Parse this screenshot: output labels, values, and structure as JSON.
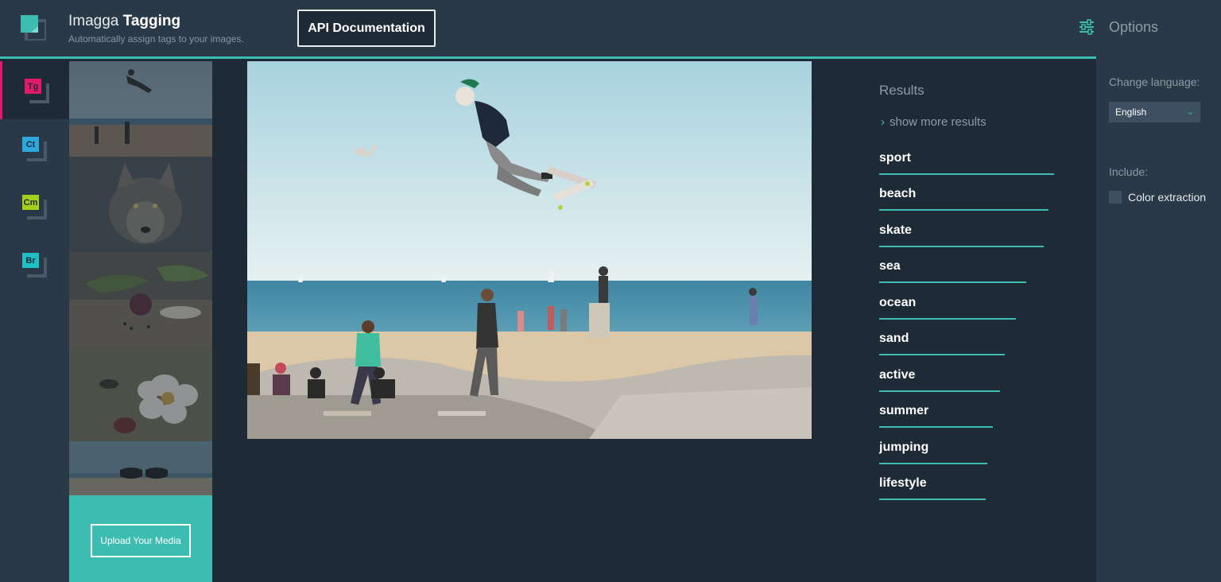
{
  "header": {
    "brand_prefix": "Imagga",
    "brand_name": "Tagging",
    "subtitle": "Automatically assign tags to your images.",
    "api_doc_label": "API Documentation"
  },
  "rail": {
    "items": [
      {
        "code": "Tg",
        "color": "#e0196b",
        "active": true
      },
      {
        "code": "Ct",
        "color": "#2ea8dc",
        "active": false
      },
      {
        "code": "Cm",
        "color": "#a6cf1a",
        "active": false
      },
      {
        "code": "Br",
        "color": "#1fbfc6",
        "active": false
      }
    ]
  },
  "thumbnails": [
    "skater-jump",
    "wolf",
    "vegetables",
    "flower-bee",
    "beach-sunglasses"
  ],
  "upload": {
    "label": "Upload Your Media"
  },
  "results": {
    "title": "Results",
    "show_more": "show more results",
    "tags": [
      "sport",
      "beach",
      "skate",
      "sea",
      "ocean",
      "sand",
      "active",
      "summer",
      "jumping",
      "lifestyle"
    ],
    "confidence_fraction": [
      1.0,
      0.97,
      0.94,
      0.84,
      0.78,
      0.72,
      0.69,
      0.65,
      0.62,
      0.61
    ]
  },
  "options": {
    "title": "Options",
    "change_language_label": "Change language:",
    "language_value": "English",
    "include_label": "Include:",
    "color_extraction_label": "Color extraction",
    "color_extraction_checked": false
  },
  "colors": {
    "accent": "#3dbdb1",
    "tagging": "#e0196b"
  }
}
